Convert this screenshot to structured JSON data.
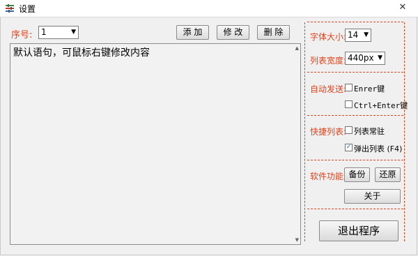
{
  "window": {
    "title": "设置",
    "close_glyph": "✕"
  },
  "top": {
    "seq_label": "序号:",
    "seq_value": "1",
    "add_label": "添 加",
    "edit_label": "修 改",
    "delete_label": "删 除"
  },
  "editor": {
    "text": "默认语句，可鼠标右键修改内容"
  },
  "font": {
    "size_label": "字体大小:",
    "size_value": "14",
    "width_label": "列表宽度:",
    "width_value": "440px"
  },
  "autosend": {
    "label": "自动发送:",
    "option1": "Enrer键",
    "option1_checked": false,
    "option2": "Ctrl+Enter键",
    "option2_checked": false
  },
  "quicklist": {
    "label": "快捷列表:",
    "option1": "列表常驻",
    "option1_checked": false,
    "option2": "弹出列表 (F4)",
    "option2_checked": true
  },
  "software": {
    "label": "软件功能:",
    "backup_label": "备份",
    "restore_label": "还原",
    "about_label": "关于"
  },
  "exit_label": "退出程序",
  "colors": {
    "accent": "#e0431b"
  }
}
